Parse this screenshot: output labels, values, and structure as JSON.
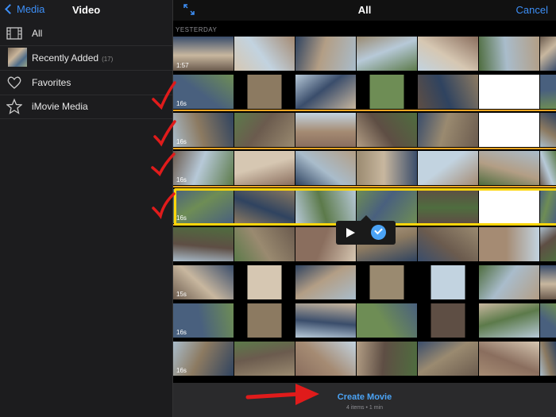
{
  "sidebar": {
    "back_label": "Media",
    "title": "Video",
    "items": [
      {
        "label": "All",
        "icon": "film-icon"
      },
      {
        "label": "Recently Added",
        "count": "(17)",
        "icon": "thumbnail-icon"
      },
      {
        "label": "Favorites",
        "icon": "heart-icon"
      },
      {
        "label": "iMovie Media",
        "icon": "star-icon"
      }
    ]
  },
  "main": {
    "title": "All",
    "cancel_label": "Cancel",
    "section_label": "YESTERDAY",
    "rows": [
      {
        "durations": [
          "1:57"
        ],
        "selected": false
      },
      {
        "durations": [
          "16s"
        ],
        "selected": true
      },
      {
        "durations": [
          "16s"
        ],
        "selected": true
      },
      {
        "durations": [
          "16s"
        ],
        "selected": true
      },
      {
        "durations": [
          "16s"
        ],
        "selected": true
      },
      {
        "durations": [
          ""
        ],
        "selected": false
      },
      {
        "durations": [
          "15s"
        ],
        "selected": false
      },
      {
        "durations": [
          "16s"
        ],
        "selected": false
      },
      {
        "durations": [
          "16s"
        ],
        "selected": false
      }
    ]
  },
  "popup": {
    "play_icon": "play-icon",
    "check_icon": "checkmark-icon"
  },
  "footer": {
    "create_label": "Create Movie",
    "subtitle": "4 items • 1 min"
  },
  "colors": {
    "accent": "#3d8ff7",
    "selection": "#f5a623",
    "highlight": "#ffd60a",
    "annotation": "#e01b1b"
  }
}
